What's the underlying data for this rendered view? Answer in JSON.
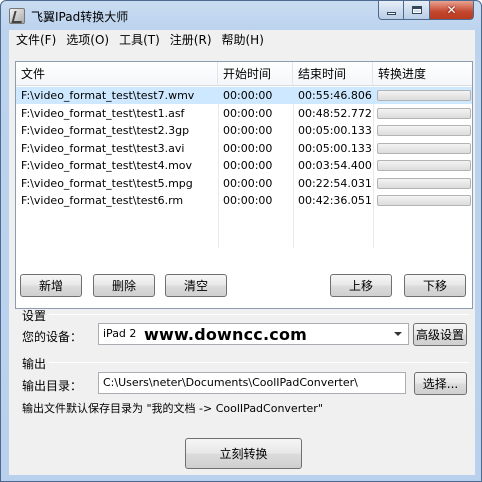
{
  "window": {
    "title": "飞翼IPad转换大师",
    "minimize_label": "minimize",
    "maximize_label": "maximize",
    "close_label": "close"
  },
  "menu": [
    "文件(F)",
    "选项(O)",
    "工具(T)",
    "注册(R)",
    "帮助(H)"
  ],
  "table": {
    "columns": [
      "文件",
      "开始时间",
      "结束时间",
      "转换进度"
    ],
    "rows": [
      {
        "file": "F:\\video_format_test\\test7.wmv",
        "start": "00:00:00",
        "end": "00:55:46.806",
        "progress": 0
      },
      {
        "file": "F:\\video_format_test\\test1.asf",
        "start": "00:00:00",
        "end": "00:48:52.772",
        "progress": 0
      },
      {
        "file": "F:\\video_format_test\\test2.3gp",
        "start": "00:00:00",
        "end": "00:05:00.133",
        "progress": 0
      },
      {
        "file": "F:\\video_format_test\\test3.avi",
        "start": "00:00:00",
        "end": "00:05:00.133",
        "progress": 0
      },
      {
        "file": "F:\\video_format_test\\test4.mov",
        "start": "00:00:00",
        "end": "00:03:54.400",
        "progress": 0
      },
      {
        "file": "F:\\video_format_test\\test5.mpg",
        "start": "00:00:00",
        "end": "00:22:54.031",
        "progress": 0
      },
      {
        "file": "F:\\video_format_test\\test6.rm",
        "start": "00:00:00",
        "end": "00:42:36.051",
        "progress": 0
      }
    ],
    "selected_row": 0
  },
  "buttons": {
    "add": "新增",
    "delete": "删除",
    "clear": "清空",
    "move_up": "上移",
    "move_down": "下移",
    "advanced": "高级设置",
    "browse": "选择...",
    "convert": "立刻转换"
  },
  "settings": {
    "group_label": "设置",
    "device_label": "您的设备：",
    "device_value": "iPad 2",
    "watermark": "www.downcc.com"
  },
  "output": {
    "group_label": "输出",
    "dir_label": "输出目录：",
    "dir_value": "C:\\Users\\neter\\Documents\\CoolIPadConverter\\",
    "hint": "输出文件默认保存目录为 \"我的文档 -> CoolIPadConverter\""
  },
  "colors": {
    "title_bar": "#c2d7ef",
    "selected_row": "#cde8ff",
    "close_button": "#c4462d",
    "progress_fill": "#37c83c"
  }
}
